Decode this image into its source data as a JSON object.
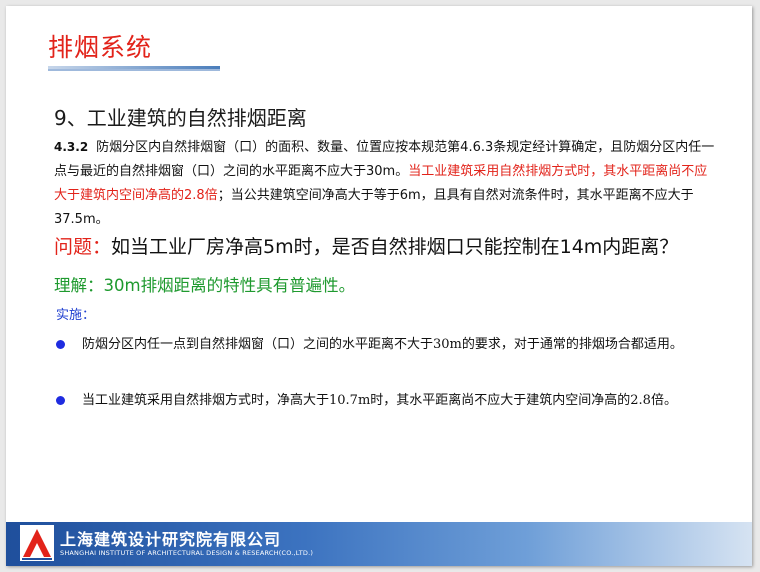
{
  "slide": {
    "title": "排烟系统",
    "heading": "9、工业建筑的自然排烟距离",
    "clause_number": "4.3.2",
    "clause_text_1": "防烟分区内自然排烟窗（口）的面积、数量、位置应按本规范第4.6.3条规定经计算确定，且防烟分区内任一点与最近的自然排烟窗（口）之间的水平距离不应大于30m。",
    "clause_text_red": "当工业建筑采用自然排烟方式时，其水平距离尚不应大于建筑内空间净高的2.8倍",
    "clause_text_2": "；当公共建筑空间净高大于等于6m，且具有自然对流条件时，其水平距离不应大于37.5m。",
    "question_label": "问题：",
    "question_text": "如当工业厂房净高5m时，是否自然排烟口只能控制在14m内距离？",
    "understanding": "理解：30m排烟距离的特性具有普遍性。",
    "implementation_label": "实施：",
    "bullets": [
      "防烟分区内任一点到自然排烟窗（口）之间的水平距离不大于30m的要求，对于通常的排烟场合都适用。",
      "当工业建筑采用自然排烟方式时，净高大于10.7m时，其水平距离尚不应大于建筑内空间净高的2.8倍。"
    ]
  },
  "footer": {
    "company_cn": "上海建筑设计研究院有限公司",
    "company_en": "SHANGHAI INSTITUTE OF ARCHITECTURAL DESIGN & RESEARCH(CO.,LTD.)",
    "logo_text": "SIADR"
  },
  "colors": {
    "title_red": "#e2231a",
    "understanding_green": "#1f9a2f",
    "implementation_blue": "#1f3fd0",
    "bullet_blue": "#1f2ce0",
    "footer_blue": "#1f4f9c"
  }
}
